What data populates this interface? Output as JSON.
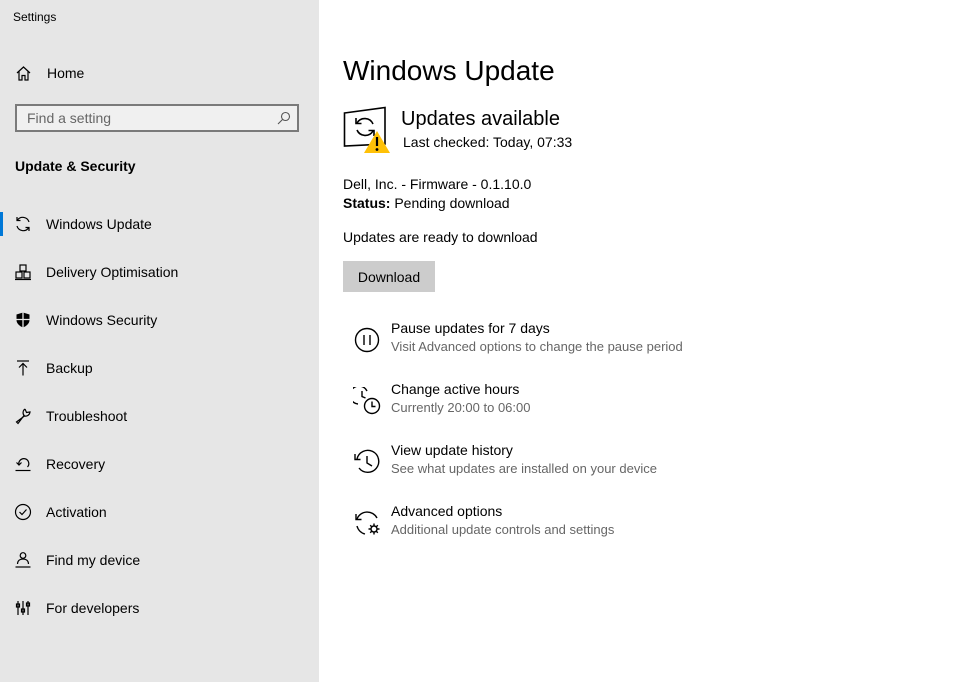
{
  "window": {
    "title": "Settings"
  },
  "sidebar": {
    "home_label": "Home",
    "search_placeholder": "Find a setting",
    "section_title": "Update & Security",
    "items": [
      {
        "label": "Windows Update",
        "icon": "refresh-icon",
        "active": true
      },
      {
        "label": "Delivery Optimisation",
        "icon": "delivery-icon"
      },
      {
        "label": "Windows Security",
        "icon": "shield-icon"
      },
      {
        "label": "Backup",
        "icon": "backup-arrow-icon"
      },
      {
        "label": "Troubleshoot",
        "icon": "wrench-icon"
      },
      {
        "label": "Recovery",
        "icon": "recovery-icon"
      },
      {
        "label": "Activation",
        "icon": "check-circle-icon"
      },
      {
        "label": "Find my device",
        "icon": "person-location-icon"
      },
      {
        "label": "For developers",
        "icon": "developer-icon"
      }
    ]
  },
  "main": {
    "title": "Windows Update",
    "status_title": "Updates available",
    "last_checked": "Last checked: Today, 07:33",
    "update_name": "Dell, Inc. - Firmware - 0.1.10.0",
    "status_label": "Status:",
    "status_value": "Pending download",
    "ready_text": "Updates are ready to download",
    "download_label": "Download",
    "options": [
      {
        "title": "Pause updates for 7 days",
        "subtitle": "Visit Advanced options to change the pause period",
        "icon": "pause-icon"
      },
      {
        "title": "Change active hours",
        "subtitle": "Currently 20:00 to 06:00",
        "icon": "active-hours-icon"
      },
      {
        "title": "View update history",
        "subtitle": "See what updates are installed on your device",
        "icon": "history-icon"
      },
      {
        "title": "Advanced options",
        "subtitle": "Additional update controls and settings",
        "icon": "advanced-gear-icon"
      }
    ]
  },
  "colors": {
    "sidebar_bg": "#e6e6e6",
    "accent": "#0078d7",
    "warning": "#ffc107",
    "button_bg": "#cccccc"
  }
}
